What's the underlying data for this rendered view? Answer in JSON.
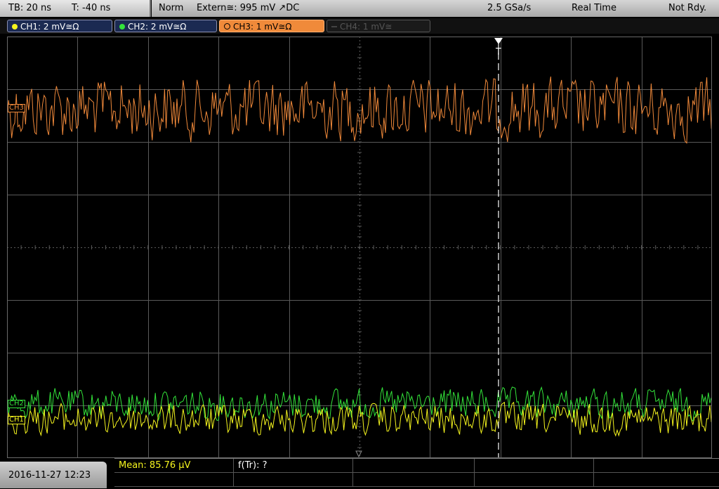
{
  "header": {
    "timebase": "TB: 20 ns",
    "trigger_time": "T: -40 ns",
    "mode": "Norm",
    "trigger_source": "Extern≅: 995 mV ↗DC",
    "sample_rate": "2.5 GSa/s",
    "acq_mode": "Real Time",
    "status": "Not Rdy."
  },
  "channels": [
    {
      "label": "CH1: 2 mV≅Ω",
      "color": "#f5f51e",
      "active": true
    },
    {
      "label": "CH2: 2 mV≅Ω",
      "color": "#33e33a",
      "active": true
    },
    {
      "label": "CH3: 1 mV≅Ω",
      "color": "#f08a3a",
      "active": true,
      "selected": true
    },
    {
      "label": "CH4: 1 mV≅",
      "color": "#555555",
      "active": false
    }
  ],
  "trigger_marker": "T",
  "channel_markers": {
    "ch1": "CH1",
    "ch2": "CH2",
    "ch3": "CH3"
  },
  "measurements": {
    "mean": "Mean: 85.76 µV",
    "ftr": "f(Tr): ?"
  },
  "footer": {
    "date": "2016-11-27  12:23"
  },
  "colors": {
    "ch1": "#f5f51e",
    "ch2": "#33e33a",
    "ch3": "#f0893a",
    "grid": "#5a5a5a"
  }
}
